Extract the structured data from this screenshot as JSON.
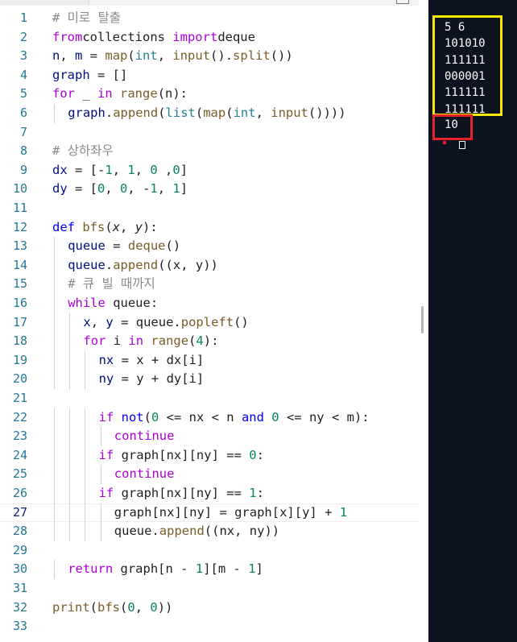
{
  "editor": {
    "lines": [
      {
        "n": "1",
        "indent": 0,
        "tokens": [
          [
            "c",
            "# 미로 탈출"
          ]
        ]
      },
      {
        "n": "2",
        "indent": 0,
        "tokens": [
          [
            "p",
            "from"
          ],
          [
            "",
            "collections "
          ],
          [
            "p",
            "import"
          ],
          [
            "",
            "deque"
          ]
        ]
      },
      {
        "n": "3",
        "indent": 0,
        "tokens": [
          [
            "v",
            "n"
          ],
          [
            "",
            ", "
          ],
          [
            "v",
            "m"
          ],
          [
            "",
            " = "
          ],
          [
            "f",
            "map"
          ],
          [
            "",
            "("
          ],
          [
            "t",
            "int"
          ],
          [
            "",
            ", "
          ],
          [
            "f",
            "input"
          ],
          [
            "",
            "()."
          ],
          [
            "f",
            "split"
          ],
          [
            "",
            "())"
          ]
        ]
      },
      {
        "n": "4",
        "indent": 0,
        "tokens": [
          [
            "v",
            "graph"
          ],
          [
            "",
            " = []"
          ]
        ]
      },
      {
        "n": "5",
        "indent": 0,
        "tokens": [
          [
            "p",
            "for"
          ],
          [
            "",
            " _ "
          ],
          [
            "p",
            "in"
          ],
          [
            "",
            " "
          ],
          [
            "f",
            "range"
          ],
          [
            "",
            "(n):"
          ]
        ]
      },
      {
        "n": "6",
        "indent": 1,
        "tokens": [
          [
            "v",
            "graph"
          ],
          [
            "",
            "."
          ],
          [
            "f",
            "append"
          ],
          [
            "",
            "("
          ],
          [
            "t",
            "list"
          ],
          [
            "",
            "("
          ],
          [
            "f",
            "map"
          ],
          [
            "",
            "("
          ],
          [
            "t",
            "int"
          ],
          [
            "",
            ", "
          ],
          [
            "f",
            "input"
          ],
          [
            "",
            "())))"
          ]
        ]
      },
      {
        "n": "7",
        "indent": 0,
        "tokens": []
      },
      {
        "n": "8",
        "indent": 0,
        "tokens": [
          [
            "c",
            "# 상하좌우"
          ]
        ]
      },
      {
        "n": "9",
        "indent": 0,
        "tokens": [
          [
            "v",
            "dx"
          ],
          [
            "",
            " = [-"
          ],
          [
            "n",
            "1"
          ],
          [
            "",
            ", "
          ],
          [
            "n",
            "1"
          ],
          [
            "",
            ", "
          ],
          [
            "n",
            "0"
          ],
          [
            "",
            " ,"
          ],
          [
            "n",
            "0"
          ],
          [
            "",
            "]"
          ]
        ]
      },
      {
        "n": "10",
        "indent": 0,
        "tokens": [
          [
            "v",
            "dy"
          ],
          [
            "",
            " = ["
          ],
          [
            "n",
            "0"
          ],
          [
            "",
            ", "
          ],
          [
            "n",
            "0"
          ],
          [
            "",
            ", -"
          ],
          [
            "n",
            "1"
          ],
          [
            "",
            ", "
          ],
          [
            "n",
            "1"
          ],
          [
            "",
            "]"
          ]
        ]
      },
      {
        "n": "11",
        "indent": 0,
        "tokens": []
      },
      {
        "n": "12",
        "indent": 0,
        "tokens": [
          [
            "k",
            "def"
          ],
          [
            "",
            " "
          ],
          [
            "fn",
            "bfs"
          ],
          [
            "",
            "("
          ],
          [
            "pi",
            "x"
          ],
          [
            "",
            ", "
          ],
          [
            "pi",
            "y"
          ],
          [
            "",
            "):"
          ]
        ]
      },
      {
        "n": "13",
        "indent": 1,
        "tokens": [
          [
            "v",
            "queue"
          ],
          [
            "",
            " = "
          ],
          [
            "f",
            "deque"
          ],
          [
            "",
            "()"
          ]
        ]
      },
      {
        "n": "14",
        "indent": 1,
        "tokens": [
          [
            "v",
            "queue"
          ],
          [
            "",
            "."
          ],
          [
            "f",
            "append"
          ],
          [
            "",
            "((x, y))"
          ]
        ]
      },
      {
        "n": "15",
        "indent": 1,
        "tokens": [
          [
            "c",
            "# 큐 빌 때까지"
          ]
        ]
      },
      {
        "n": "16",
        "indent": 1,
        "tokens": [
          [
            "p",
            "while"
          ],
          [
            "",
            " queue:"
          ]
        ]
      },
      {
        "n": "17",
        "indent": 2,
        "tokens": [
          [
            "v",
            "x"
          ],
          [
            "",
            ", "
          ],
          [
            "v",
            "y"
          ],
          [
            "",
            " = queue."
          ],
          [
            "f",
            "popleft"
          ],
          [
            "",
            "()"
          ]
        ]
      },
      {
        "n": "18",
        "indent": 2,
        "tokens": [
          [
            "p",
            "for"
          ],
          [
            "",
            " i "
          ],
          [
            "p",
            "in"
          ],
          [
            "",
            " "
          ],
          [
            "f",
            "range"
          ],
          [
            "",
            "("
          ],
          [
            "n",
            "4"
          ],
          [
            "",
            "):"
          ]
        ]
      },
      {
        "n": "19",
        "indent": 3,
        "tokens": [
          [
            "v",
            "nx"
          ],
          [
            "",
            " = x + dx[i]"
          ]
        ]
      },
      {
        "n": "20",
        "indent": 3,
        "tokens": [
          [
            "v",
            "ny"
          ],
          [
            "",
            " = y + dy[i]"
          ]
        ]
      },
      {
        "n": "21",
        "indent": 0,
        "tokens": []
      },
      {
        "n": "22",
        "indent": 3,
        "tokens": [
          [
            "p",
            "if"
          ],
          [
            "",
            " "
          ],
          [
            "k",
            "not"
          ],
          [
            "",
            "("
          ],
          [
            "n",
            "0"
          ],
          [
            "",
            " <= nx < n "
          ],
          [
            "k",
            "and"
          ],
          [
            "",
            " "
          ],
          [
            "n",
            "0"
          ],
          [
            "",
            " <= ny < m):"
          ]
        ]
      },
      {
        "n": "23",
        "indent": 4,
        "tokens": [
          [
            "p",
            "continue"
          ]
        ]
      },
      {
        "n": "24",
        "indent": 3,
        "tokens": [
          [
            "p",
            "if"
          ],
          [
            "",
            " graph[nx][ny] == "
          ],
          [
            "n",
            "0"
          ],
          [
            "",
            ":"
          ]
        ]
      },
      {
        "n": "25",
        "indent": 4,
        "tokens": [
          [
            "p",
            "continue"
          ]
        ]
      },
      {
        "n": "26",
        "indent": 3,
        "tokens": [
          [
            "p",
            "if"
          ],
          [
            "",
            " graph[nx][ny] == "
          ],
          [
            "n",
            "1"
          ],
          [
            "",
            ":"
          ]
        ]
      },
      {
        "n": "27",
        "indent": 4,
        "tokens": [
          [
            "",
            "graph[nx][ny] = graph[x][y] + "
          ],
          [
            "n",
            "1"
          ]
        ]
      },
      {
        "n": "28",
        "indent": 4,
        "tokens": [
          [
            "",
            "queue."
          ],
          [
            "f",
            "append"
          ],
          [
            "",
            "((nx, ny))"
          ]
        ]
      },
      {
        "n": "29",
        "indent": 0,
        "tokens": []
      },
      {
        "n": "30",
        "indent": 1,
        "tokens": [
          [
            "p",
            "return"
          ],
          [
            "",
            " graph[n - "
          ],
          [
            "n",
            "1"
          ],
          [
            "",
            "][m - "
          ],
          [
            "n",
            "1"
          ],
          [
            "",
            "]"
          ]
        ]
      },
      {
        "n": "31",
        "indent": 0,
        "tokens": []
      },
      {
        "n": "32",
        "indent": 0,
        "tokens": [
          [
            "f",
            "print"
          ],
          [
            "",
            "("
          ],
          [
            "fn",
            "bfs"
          ],
          [
            "",
            "("
          ],
          [
            "n",
            "0"
          ],
          [
            "",
            ", "
          ],
          [
            "n",
            "0"
          ],
          [
            "",
            "))"
          ]
        ]
      },
      {
        "n": "33",
        "indent": 0,
        "tokens": []
      }
    ],
    "active_line": "27"
  },
  "terminal": {
    "input_lines": [
      "5 6",
      "101010",
      "111111",
      "000001",
      "111111",
      "111111"
    ],
    "output": "10"
  },
  "colors": {
    "highlight_input": "#f7e600",
    "highlight_output": "#e8202a",
    "terminal_bg": "#0c1220"
  }
}
